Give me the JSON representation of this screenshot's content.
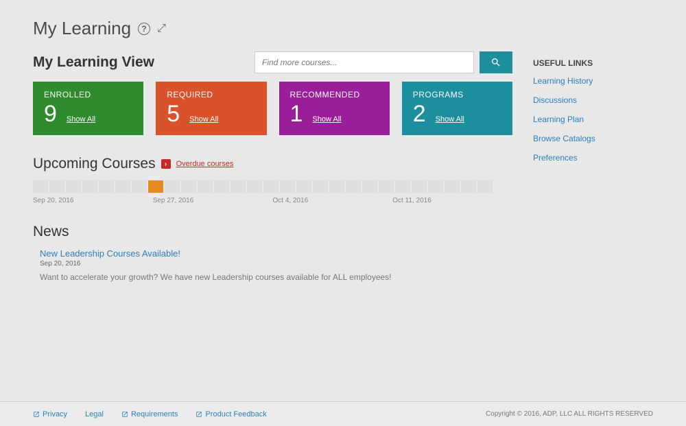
{
  "header": {
    "title": "My Learning"
  },
  "subheader": "My Learning View",
  "search": {
    "placeholder": "Find more courses..."
  },
  "tiles": {
    "enrolled": {
      "label": "ENROLLED",
      "count": "9",
      "show_all": "Show All"
    },
    "required": {
      "label": "REQUIRED",
      "count": "5",
      "show_all": "Show All"
    },
    "recommended": {
      "label": "RECOMMENDED",
      "count": "1",
      "show_all": "Show All"
    },
    "programs": {
      "label": "PROGRAMS",
      "count": "2",
      "show_all": "Show All"
    }
  },
  "upcoming": {
    "title": "Upcoming Courses",
    "overdue_label": "Overdue courses",
    "dates": {
      "d0": "Sep 20, 2016",
      "d1": "Sep 27, 2016",
      "d2": "Oct 4, 2016",
      "d3": "Oct 11, 2016"
    }
  },
  "news": {
    "title": "News",
    "items": {
      "0": {
        "headline": "New Leadership Courses Available!",
        "date": "Sep 20, 2016",
        "body": "Want to accelerate your growth? We have new Leadership courses available for ALL employees!"
      }
    }
  },
  "sidebar": {
    "title": "USEFUL LINKS",
    "links": {
      "0": "Learning History",
      "1": "Discussions",
      "2": "Learning Plan",
      "3": "Browse Catalogs",
      "4": "Preferences"
    }
  },
  "footer": {
    "privacy": "Privacy",
    "legal": "Legal",
    "requirements": "Requirements",
    "feedback": "Product Feedback",
    "copyright": "Copyright © 2016, ADP, LLC ALL RIGHTS RESERVED"
  }
}
